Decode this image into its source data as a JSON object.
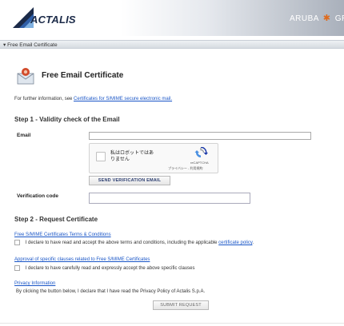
{
  "header": {
    "brand": "ACTALIS",
    "group_left": "ARUBA",
    "group_right": "GROU",
    "brand_color": "#1b2a48",
    "accent": "#e06a1b"
  },
  "section_bar": {
    "label": "▾ Free Email Certificate"
  },
  "page": {
    "title": "Free Email Certificate",
    "icon": "certificate-envelope-icon",
    "info_prefix": "For further information, see ",
    "info_link": "Certificates for S/MIME secure electronic mail."
  },
  "step1": {
    "heading": "Step 1 - Validity check of the Email",
    "email_label": "Email",
    "email_value": "",
    "captcha": {
      "checkbox_label": "私はロボットではありません",
      "brand": "reCAPTCHA",
      "terms": "プライバシー - 利用規約"
    },
    "verify_button": "SEND VERIFICATION EMAIL",
    "code_label": "Verification code",
    "code_value": ""
  },
  "step2": {
    "heading": "Step 2 - Request Certificate",
    "terms_link": "Free S/MIME Certificates Terms & Conditions",
    "terms_text": " I declare to have read and accept the above terms and conditions, including the applicable ",
    "policy_link": "certificate policy",
    "terms_end": ".",
    "clauses_link": "Approval of specific clauses related to Free S/MIME Certificates",
    "clauses_text": " I declare to have carefully read and expressly accept the above specific clauses",
    "privacy_link": "Privacy Information",
    "privacy_text": "By clicking the button below, I declare that I have read the Privacy Policy of Actalis S.p.A.",
    "submit_button": "SUBMIT REQUEST"
  }
}
